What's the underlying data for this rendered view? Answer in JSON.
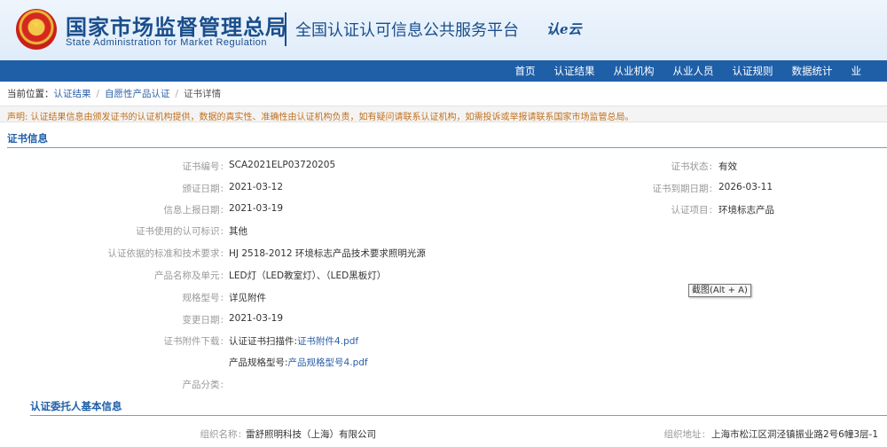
{
  "header": {
    "title_cn": "国家市场监督管理总局",
    "title_en": "State Administration  for  Market Regulation",
    "platform": "全国认证认可信息公共服务平台",
    "logo_text": "认e云",
    "emblem_icon": "national-emblem-icon",
    "brand_color": "#1f5fa8"
  },
  "nav": {
    "items": [
      "首页",
      "认证结果",
      "从业机构",
      "从业人员",
      "认证规则",
      "数据统计",
      "业"
    ]
  },
  "breadcrumb": {
    "prefix": "当前位置：",
    "links": [
      "认证结果",
      "自愿性产品认证"
    ],
    "current": "证书详情"
  },
  "notice": "声明: 认证结果信息由颁发证书的认证机构提供，数据的真实性、准确性由认证机构负责，如有疑问请联系认证机构，如需投诉或举报请联系国家市场监管总局。",
  "sections": {
    "cert_info": "证书信息",
    "client_info": "认证委托人基本信息"
  },
  "cert": {
    "cert_no_label": "证书编号",
    "cert_no": "SCA2021ELP03720205",
    "issue_date_label": "颁证日期",
    "issue_date": "2021-03-12",
    "report_date_label": "信息上报日期",
    "report_date": "2021-03-19",
    "mark_label": "证书使用的认可标识",
    "mark": "其他",
    "standard_label": "认证依据的标准和技术要求",
    "standard": "HJ 2518-2012 环境标志产品技术要求照明光源",
    "product_label": "产品名称及单元",
    "product": "LED灯（LED教室灯）、（LED黑板灯）",
    "model_label": "规格型号",
    "model": "详见附件",
    "change_date_label": "变更日期",
    "change_date": "2021-03-19",
    "attach_label": "证书附件下载",
    "attach1_prefix": "认证证书扫描件:",
    "attach1_link": "证书附件4.pdf",
    "attach2_prefix": "产品规格型号:",
    "attach2_link": "产品规格型号4.pdf",
    "category_label": "产品分类",
    "status_label": "证书状态",
    "status": "有效",
    "expire_label": "证书到期日期",
    "expire": "2026-03-11",
    "project_label": "认证项目",
    "project": "环境标志产品"
  },
  "client": {
    "org_label": "组织名称",
    "org": "雷舒照明科技（上海）有限公司",
    "addr_label": "组织地址",
    "addr": "上海市松江区洞泾镇振业路2号6幢3层-1"
  },
  "tooltip": "截图(Alt + A)"
}
